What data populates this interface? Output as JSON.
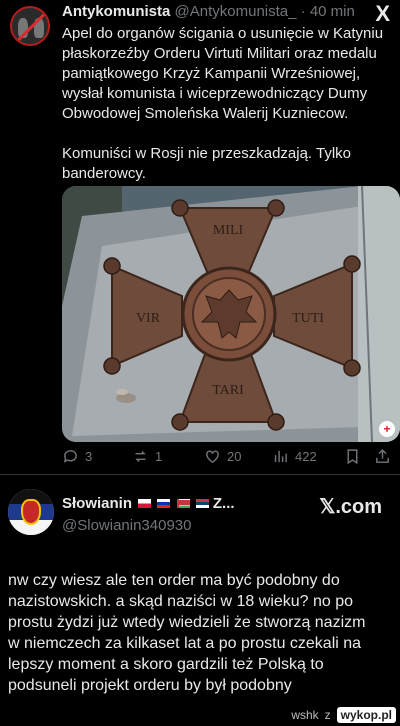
{
  "tweet": {
    "author_name": "Antykomunista",
    "author_handle": "@Antykomunista_",
    "time": "· 40 min",
    "x_logo": "X",
    "text_lines": [
      "Apel do organów ścigania o usunięcie w Katyniu",
      "płaskorzeźby Orderu Virtuti Militari oraz medalu",
      "pamiątkowego Krzyż Kampanii Wrześniowej,",
      "wysłał komunista i wiceprzewodniczący Dumy",
      "Obwodowej Smoleńska Walerij Kuzniecow."
    ],
    "text2_lines": [
      "Komuniści w Rosji nie przeszkadzają. Tylko",
      "banderowcy."
    ],
    "image": {
      "inscriptions": [
        "MILI",
        "VIR",
        "TUTI",
        "TARI"
      ],
      "expand_glyph": "+"
    },
    "actions": {
      "replies": "3",
      "reposts": "1",
      "likes": "20",
      "views": "422"
    },
    "icons": [
      "reply-icon",
      "repost-icon",
      "like-icon",
      "views-icon",
      "bookmark-icon",
      "share-icon"
    ]
  },
  "reply": {
    "author_name": "Słowianin",
    "name_suffix": "Z...",
    "author_handle": "@Slowianin340930",
    "brand": "𝕏.com",
    "flags": [
      "poland-flag",
      "russia-flag",
      "belarus-flag",
      "serbia-flag"
    ],
    "text_lines": [
      "nw czy wiesz ale ten order ma być podobny do",
      "nazistowskich. a skąd naziści w 18 wieku? no po",
      "prostu żydzi już wtedy wiedzieli że stworzą nazizm",
      "w niemczech za kilkaset lat a po prostu czekali na",
      "lepszy moment a skoro gardzili też Polską to",
      "podsuneli projekt orderu by był podobny"
    ]
  },
  "footer": {
    "user": "wshk",
    "separator": "z",
    "site": "wykop.pl"
  },
  "colors": {
    "background": "#000000",
    "text": "#e7e9ea",
    "muted": "#71767b",
    "divider": "#2f3336"
  }
}
